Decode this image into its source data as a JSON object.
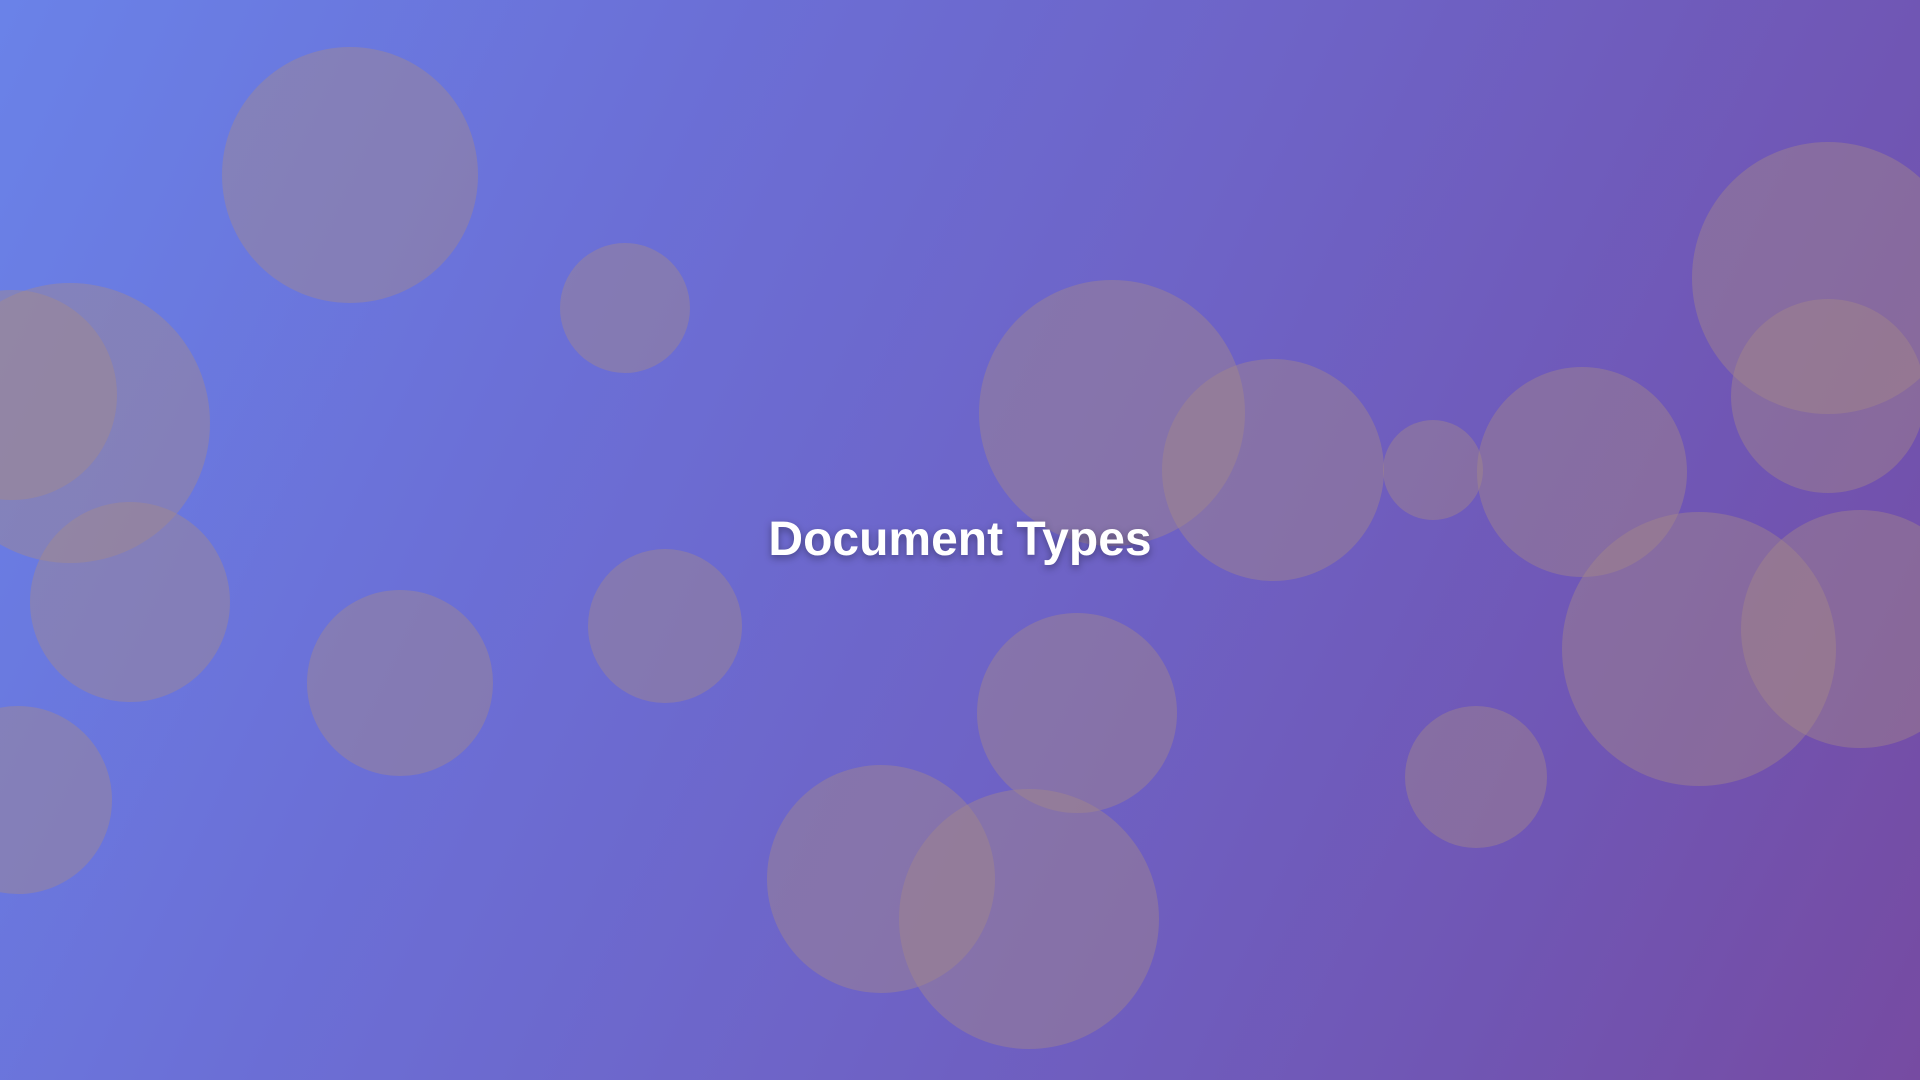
{
  "page": {
    "title": "Document Types"
  },
  "colors": {
    "gradient_start": "#6a82e8",
    "gradient_end": "#764ba2",
    "bubble": "#a88a86",
    "title_text": "#ffffff"
  }
}
